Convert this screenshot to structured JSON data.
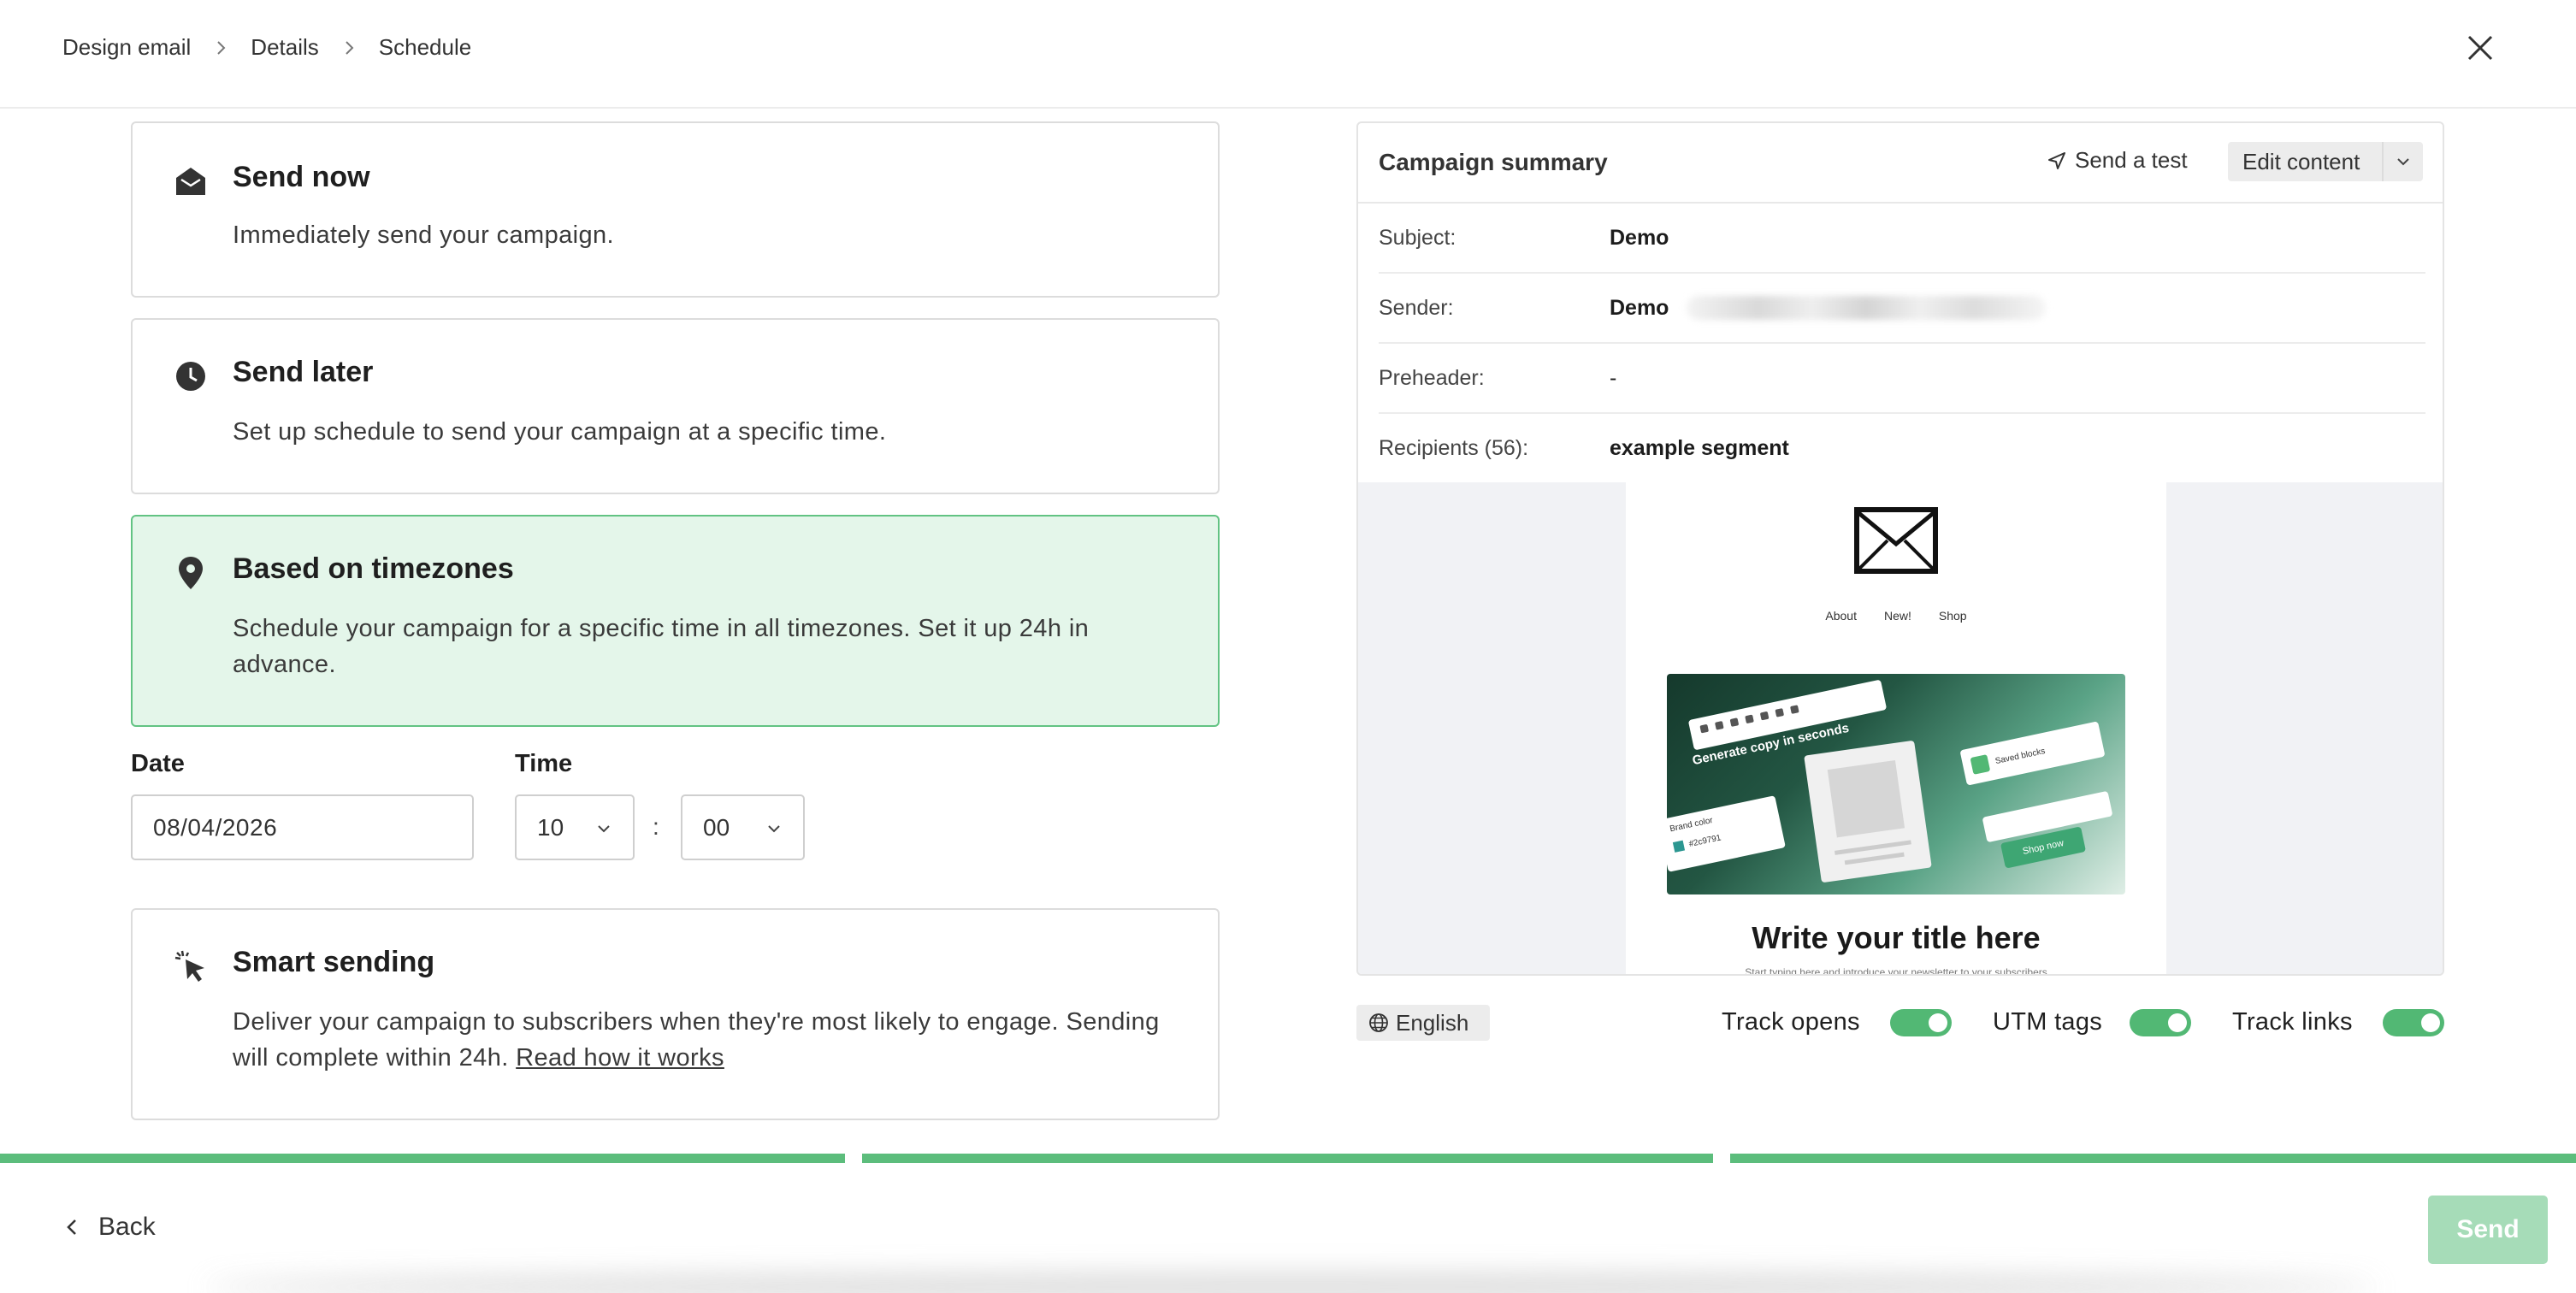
{
  "breadcrumb": {
    "items": [
      "Design email",
      "Details",
      "Schedule"
    ]
  },
  "options": {
    "send_now": {
      "title": "Send now",
      "description": "Immediately send your campaign."
    },
    "send_later": {
      "title": "Send later",
      "description": "Set up schedule to send your campaign at a specific time."
    },
    "timezones": {
      "title": "Based on timezones",
      "description": "Schedule your campaign for a specific time in all timezones. Set it up 24h in advance.",
      "selected": true
    },
    "smart": {
      "title": "Smart sending",
      "description": "Deliver your campaign to subscribers when they're most likely to engage. Sending will complete within 24h.",
      "link": "Read how it works"
    }
  },
  "schedule": {
    "date_label": "Date",
    "date_value": "08/04/2026",
    "time_label": "Time",
    "hour": "10",
    "minute": "00",
    "separator": ":"
  },
  "summary": {
    "title": "Campaign summary",
    "send_test": "Send a test",
    "edit_content": "Edit content",
    "rows": [
      {
        "key": "Subject:",
        "value": "Demo"
      },
      {
        "key": "Sender:",
        "value": "Demo"
      },
      {
        "key": "Preheader:",
        "value": "-"
      },
      {
        "key": "Recipients (56):",
        "value": "example segment"
      }
    ],
    "preview": {
      "nav": [
        "About",
        "New!",
        "Shop"
      ],
      "hero_text": "Generate copy in seconds",
      "hero_saved": "Saved blocks",
      "hero_brand": "Brand color",
      "hero_hex": "#2c9791",
      "hero_shop": "Shop now",
      "title": "Write your title here",
      "subtitle": "Start typing here and introduce your newsletter to your subscribers"
    }
  },
  "tracking": {
    "language": "English",
    "track_opens": {
      "label": "Track opens",
      "on": true
    },
    "utm_tags": {
      "label": "UTM tags",
      "on": true
    },
    "track_links": {
      "label": "Track links",
      "on": true
    }
  },
  "progress": {
    "steps_completed": 3,
    "steps_total": 3,
    "color": "#5cbd7c"
  },
  "footer": {
    "back": "Back",
    "send": "Send"
  },
  "colors": {
    "accent": "#52b874",
    "selected_bg": "#e4f6ea",
    "send_disabled": "#a6dcb8"
  }
}
